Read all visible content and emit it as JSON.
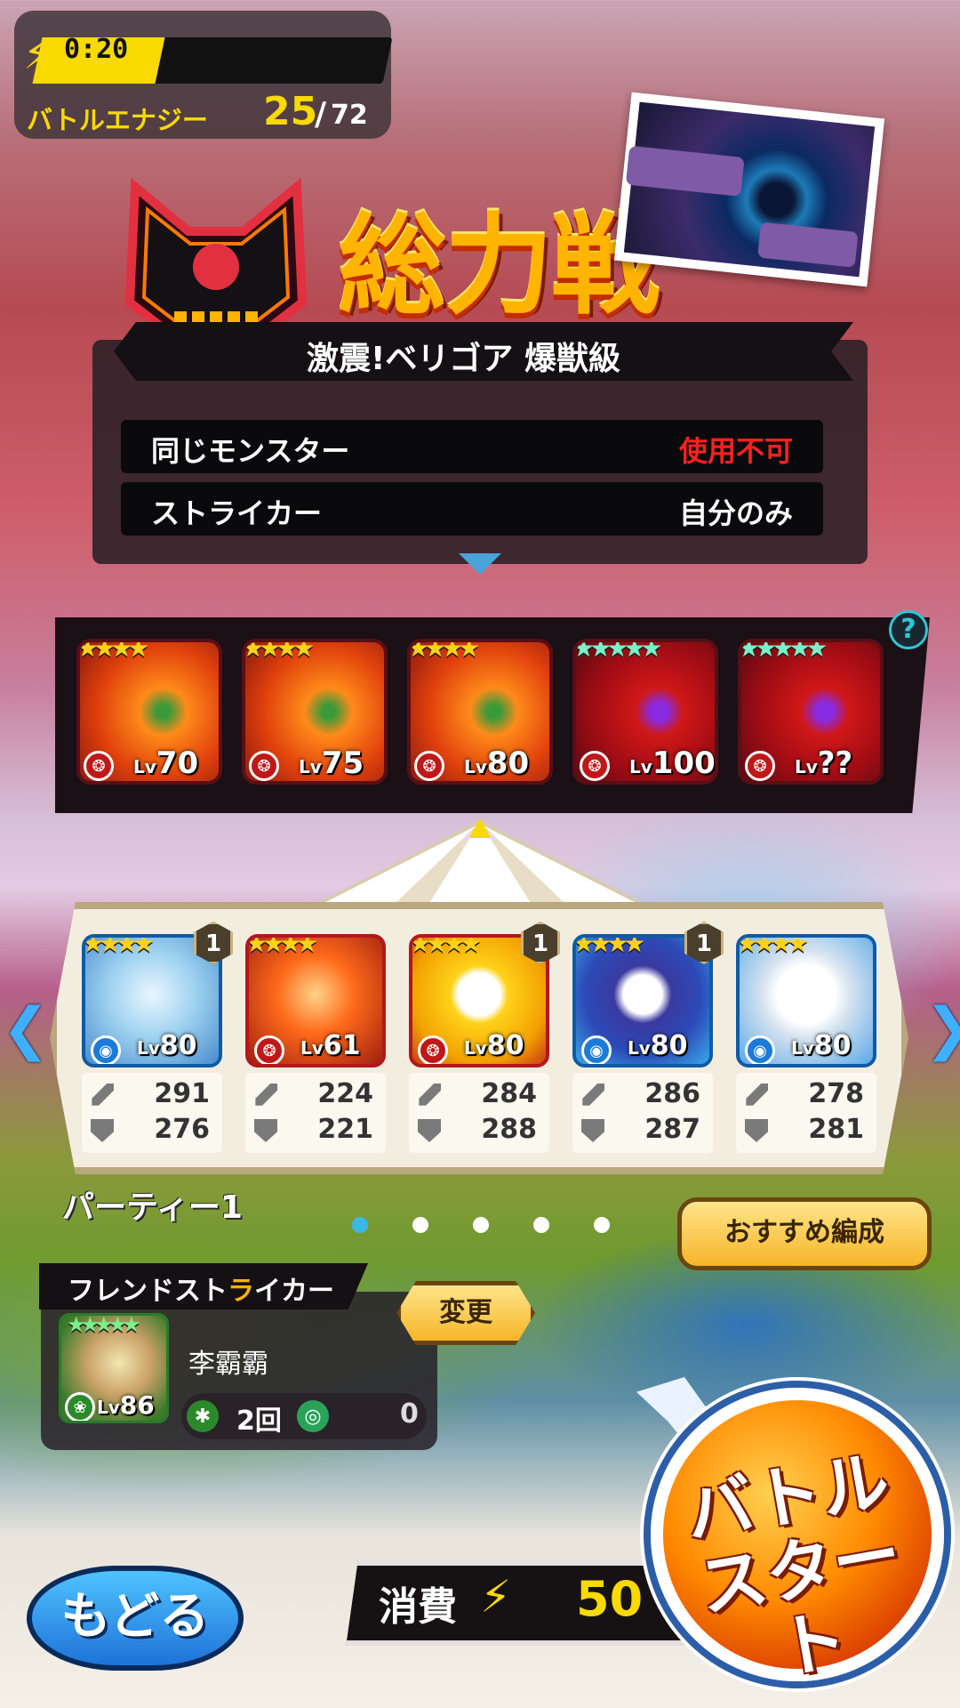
{
  "energy": {
    "timer": "0:20",
    "label": "バトルエナジー",
    "current": "25",
    "slash": "/",
    "max": "72",
    "fill": 0.35
  },
  "quest": {
    "title": "総力戦",
    "subtitle": "激震!ベリゴア 爆獣級",
    "rules": [
      {
        "key": "同じモンスター",
        "value": "使用不可",
        "value_color": "#ff2020"
      },
      {
        "key": "ストライカー",
        "value": "自分のみ",
        "value_color": "#ffffff"
      }
    ]
  },
  "enemies": [
    {
      "stars": "★★★★",
      "level_prefix": "Lv",
      "level": "70",
      "variant": "orange"
    },
    {
      "stars": "★★★★",
      "level_prefix": "Lv",
      "level": "75",
      "variant": "orange"
    },
    {
      "stars": "★★★★",
      "level_prefix": "Lv",
      "level": "80",
      "variant": "orange"
    },
    {
      "stars": "★★★★★",
      "level_prefix": "Lv",
      "level": "100",
      "variant": "red"
    },
    {
      "stars": "★★★★★",
      "level_prefix": "Lv",
      "level": "??",
      "variant": "red"
    }
  ],
  "help_icon": "?",
  "party": {
    "name": "パーティー1",
    "page_count": 5,
    "active_page": 1,
    "members": [
      {
        "stars": "★★★★",
        "badge": "1",
        "level_prefix": "Lv",
        "level": "80",
        "attack": "291",
        "defense": "276",
        "frame": "#0e5ba5",
        "element": "water"
      },
      {
        "stars": "★★★★",
        "badge": "",
        "level_prefix": "Lv",
        "level": "61",
        "attack": "224",
        "defense": "221",
        "frame": "#b3171c",
        "element": "fire"
      },
      {
        "stars": "★★★★",
        "badge": "1",
        "level_prefix": "Lv",
        "level": "80",
        "attack": "284",
        "defense": "288",
        "frame": "#b3171c",
        "element": "fire"
      },
      {
        "stars": "★★★★",
        "badge": "1",
        "level_prefix": "Lv",
        "level": "80",
        "attack": "286",
        "defense": "287",
        "frame": "#0e5ba5",
        "element": "water"
      },
      {
        "stars": "★★★★",
        "badge": "",
        "level_prefix": "Lv",
        "level": "80",
        "attack": "278",
        "defense": "281",
        "frame": "#0e5ba5",
        "element": "water"
      }
    ],
    "recommend_label": "おすすめ編成"
  },
  "friend": {
    "section_label_a": "フレンドスト",
    "section_label_hl": "ラ",
    "section_label_b": "イカー",
    "change_label": "変更",
    "stars": "★★★★★",
    "level_prefix": "Lv",
    "level": "86",
    "name": "李霸霸",
    "count": "2回",
    "extra": "0"
  },
  "back_label": "もどる",
  "cost": {
    "label": "消費",
    "value": "50"
  },
  "start_label_line1": "バトル",
  "start_label_line2": "スタート",
  "colors": {
    "gold": "#f8d900",
    "accent_blue": "#3fb0ff",
    "warning_red": "#ff2020"
  }
}
